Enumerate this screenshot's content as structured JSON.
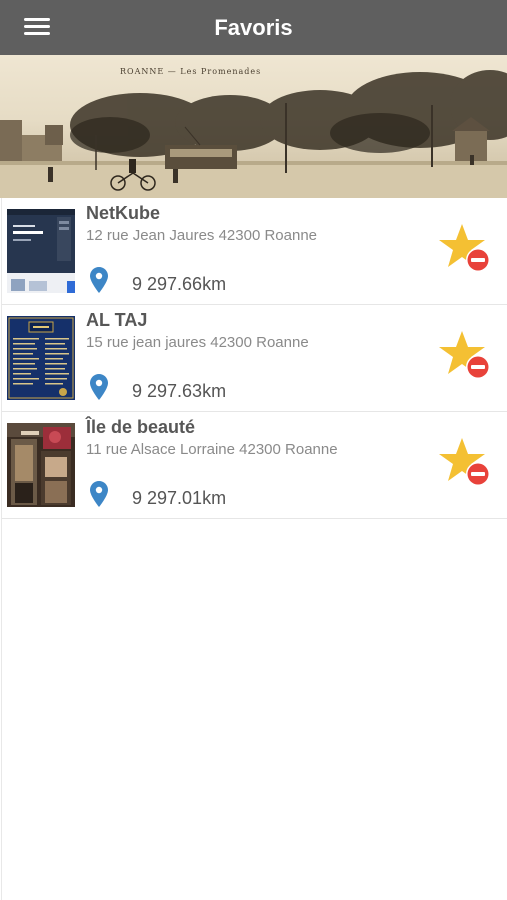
{
  "header": {
    "title": "Favoris",
    "menu_icon": "hamburger-menu-icon",
    "background_color": "#5f5f5f"
  },
  "banner": {
    "caption": "ROANNE — Les Promenades"
  },
  "favorites": [
    {
      "name": "NetKube",
      "address": "12 rue Jean Jaures 42300 Roanne",
      "distance": "9 297.66km",
      "thumbnail": "website-screenshot-thumbnail"
    },
    {
      "name": "AL TAJ",
      "address": "15 rue jean jaures 42300 Roanne",
      "distance": "9 297.63km",
      "thumbnail": "restaurant-menu-thumbnail"
    },
    {
      "name": "Île de beauté",
      "address": "11 rue Alsace Lorraine  42300 Roanne",
      "distance": "9 297.01km",
      "thumbnail": "storefront-thumbnail"
    }
  ],
  "icons": {
    "location": "map-pin-icon",
    "remove_favorite": "star-remove-icon"
  },
  "colors": {
    "star": "#f4c033",
    "remove_badge": "#e8423a",
    "pin": "#3d86c6"
  }
}
